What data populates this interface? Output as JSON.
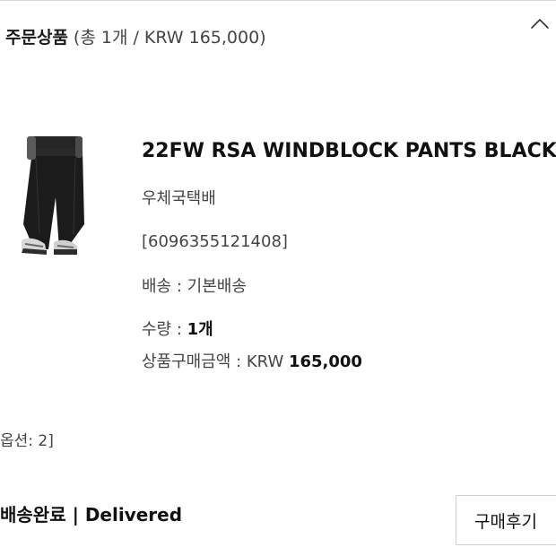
{
  "order_section": {
    "title": "주문상품",
    "summary": "(총 1개 / KRW 165,000)",
    "toggle_icon": "chevron-up-icon"
  },
  "product": {
    "image_icon": "product-photo-black-pants",
    "name": "22FW RSA WINDBLOCK PANTS BLACK",
    "shipper": "우체국택배",
    "tracking_code": "[6096355121408]",
    "shipping_label": "배송 : ",
    "shipping_value": "기본배송",
    "quantity_label": "수량 : ",
    "quantity_value": "1개",
    "amount_label": "상품구매금액 : KRW ",
    "amount_value": "165,000"
  },
  "option_text": "옵션: 2]",
  "delivery_status": "배송완료 | Delivered",
  "review_button_label": "구매후기"
}
